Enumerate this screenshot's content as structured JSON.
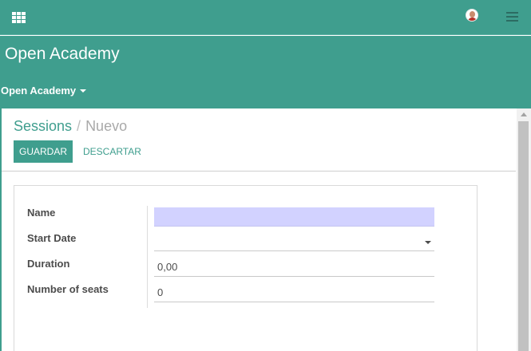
{
  "topbar": {
    "apps_icon": "apps-grid-icon",
    "avatar_icon": "user-avatar-icon",
    "menu_icon": "hamburger-icon"
  },
  "header": {
    "app_title": "Open Academy",
    "menu_label": "Open Academy"
  },
  "breadcrumb": {
    "parent": "Sessions",
    "separator": "/",
    "current": "Nuevo"
  },
  "buttons": {
    "save_label": "GUARDAR",
    "discard_label": "DESCARTAR"
  },
  "form": {
    "fields": [
      {
        "label": "Name",
        "value": "",
        "required": true
      },
      {
        "label": "Start Date",
        "value": ""
      },
      {
        "label": "Duration",
        "value": "0,00"
      },
      {
        "label": "Number of seats",
        "value": "0"
      }
    ]
  },
  "colors": {
    "primary": "#3f9e8e",
    "required_field": "#d2d2ff",
    "text": "#4c4c4c"
  }
}
